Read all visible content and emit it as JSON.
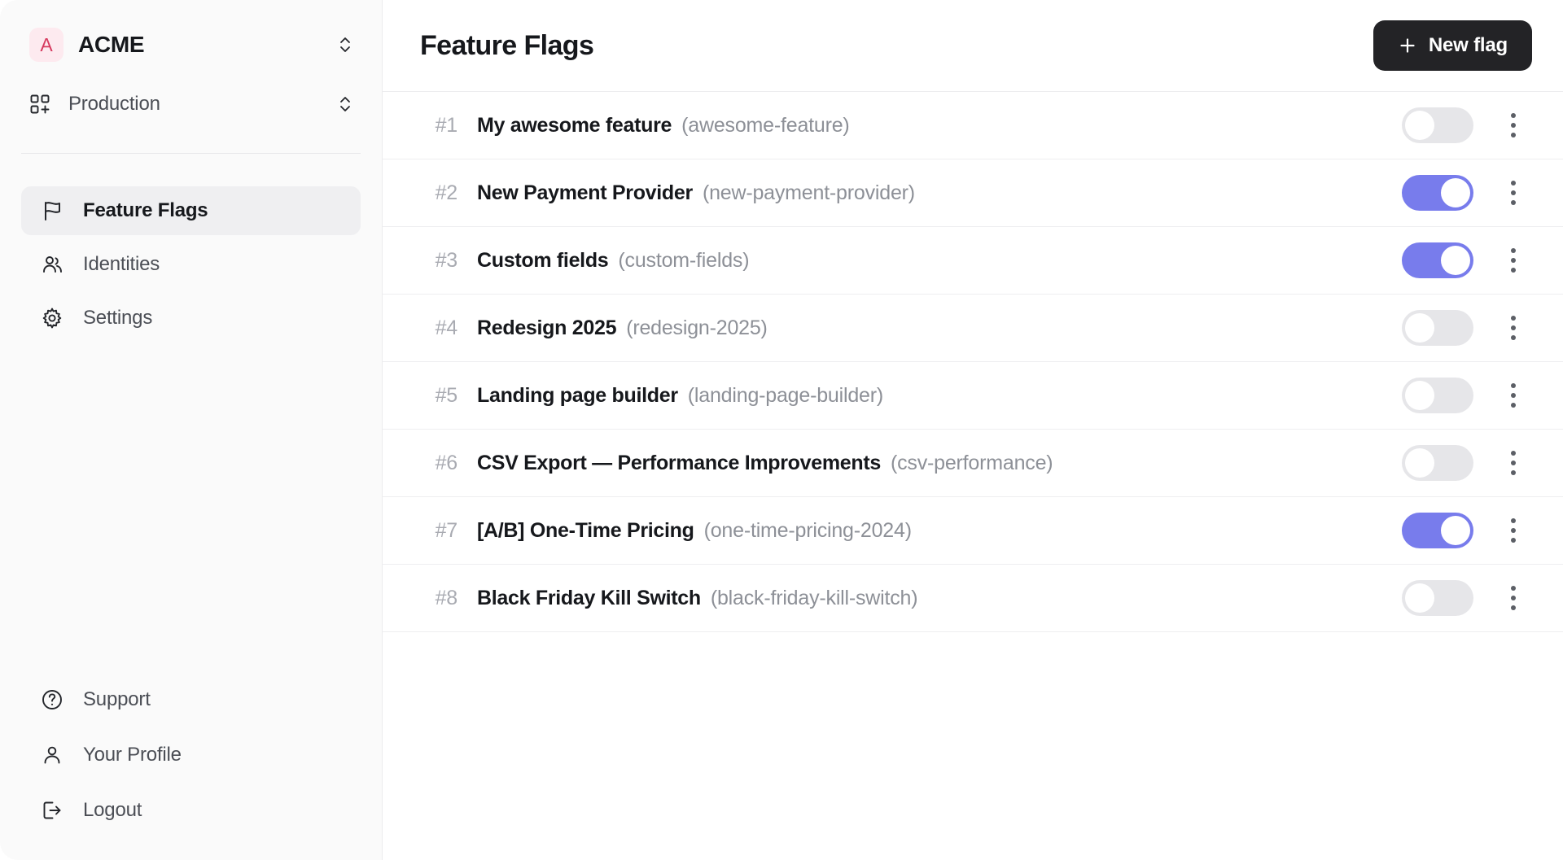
{
  "sidebar": {
    "org": {
      "badge_letter": "A",
      "name": "ACME",
      "switch_icon": "chevron-up-down-icon",
      "badge_color": "#fdeaef",
      "badge_text_color": "#d63a5e"
    },
    "environment": {
      "icon": "grid-plus-icon",
      "name": "Production",
      "switch_icon": "chevron-up-down-icon"
    },
    "nav_main": [
      {
        "label": "Feature Flags",
        "icon": "flag-icon",
        "active": true
      },
      {
        "label": "Identities",
        "icon": "users-icon",
        "active": false
      },
      {
        "label": "Settings",
        "icon": "gear-icon",
        "active": false
      }
    ],
    "nav_bottom": [
      {
        "label": "Support",
        "icon": "question-circle-icon"
      },
      {
        "label": "Your Profile",
        "icon": "user-icon"
      },
      {
        "label": "Logout",
        "icon": "logout-icon"
      }
    ]
  },
  "header": {
    "title": "Feature Flags",
    "new_flag_label": "New flag",
    "new_flag_icon": "plus-icon",
    "new_flag_bg": "#232326"
  },
  "flags": {
    "row_menu_icon": "kebab-menu-icon",
    "toggle_on_color": "#787cec",
    "toggle_off_color": "#e6e6e9",
    "items": [
      {
        "index": "#1",
        "name": "My awesome feature",
        "key": "(awesome-feature)",
        "enabled": false
      },
      {
        "index": "#2",
        "name": "New Payment Provider",
        "key": "(new-payment-provider)",
        "enabled": true
      },
      {
        "index": "#3",
        "name": "Custom fields",
        "key": "(custom-fields)",
        "enabled": true
      },
      {
        "index": "#4",
        "name": "Redesign 2025",
        "key": "(redesign-2025)",
        "enabled": false
      },
      {
        "index": "#5",
        "name": "Landing page builder",
        "key": "(landing-page-builder)",
        "enabled": false
      },
      {
        "index": "#6",
        "name": "CSV Export — Performance Improvements",
        "key": "(csv-performance)",
        "enabled": false
      },
      {
        "index": "#7",
        "name": "[A/B] One-Time Pricing",
        "key": "(one-time-pricing-2024)",
        "enabled": true
      },
      {
        "index": "#8",
        "name": "Black Friday Kill Switch",
        "key": "(black-friday-kill-switch)",
        "enabled": false
      }
    ]
  }
}
